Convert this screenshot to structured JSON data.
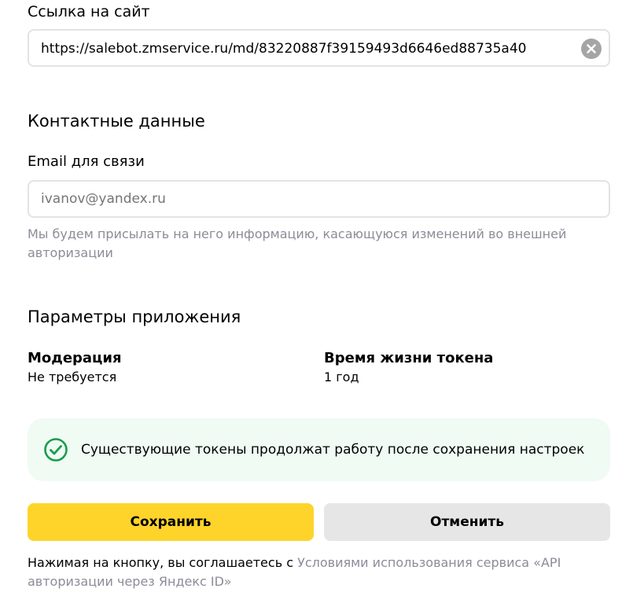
{
  "site_link": {
    "label": "Ссылка на сайт",
    "value": "https://salebot.zmservice.ru/md/83220887f39159493d6646ed88735a40"
  },
  "contacts": {
    "title": "Контактные данные",
    "email_label": "Email для связи",
    "email_placeholder": "ivanov@yandex.ru",
    "email_value": "",
    "email_hint": "Мы будем присылать на него информацию, касающуюся изменений во внешней авторизации"
  },
  "app_params": {
    "title": "Параметры приложения",
    "moderation_label": "Модерация",
    "moderation_value": "Не требуется",
    "token_lifetime_label": "Время жизни токена",
    "token_lifetime_value": "1 год"
  },
  "notice": {
    "text": "Существующие токены продолжат работу после сохранения настроек",
    "icon": "check-circle-icon",
    "color": "#1a9c4b"
  },
  "buttons": {
    "save_label": "Сохранить",
    "cancel_label": "Отменить",
    "primary_color": "#fed42b"
  },
  "legal": {
    "prefix": "Нажимая на кнопку, вы соглашаетесь с ",
    "link_text": "Условиями использования сервиса «API авторизации через Яндекс ID»"
  }
}
